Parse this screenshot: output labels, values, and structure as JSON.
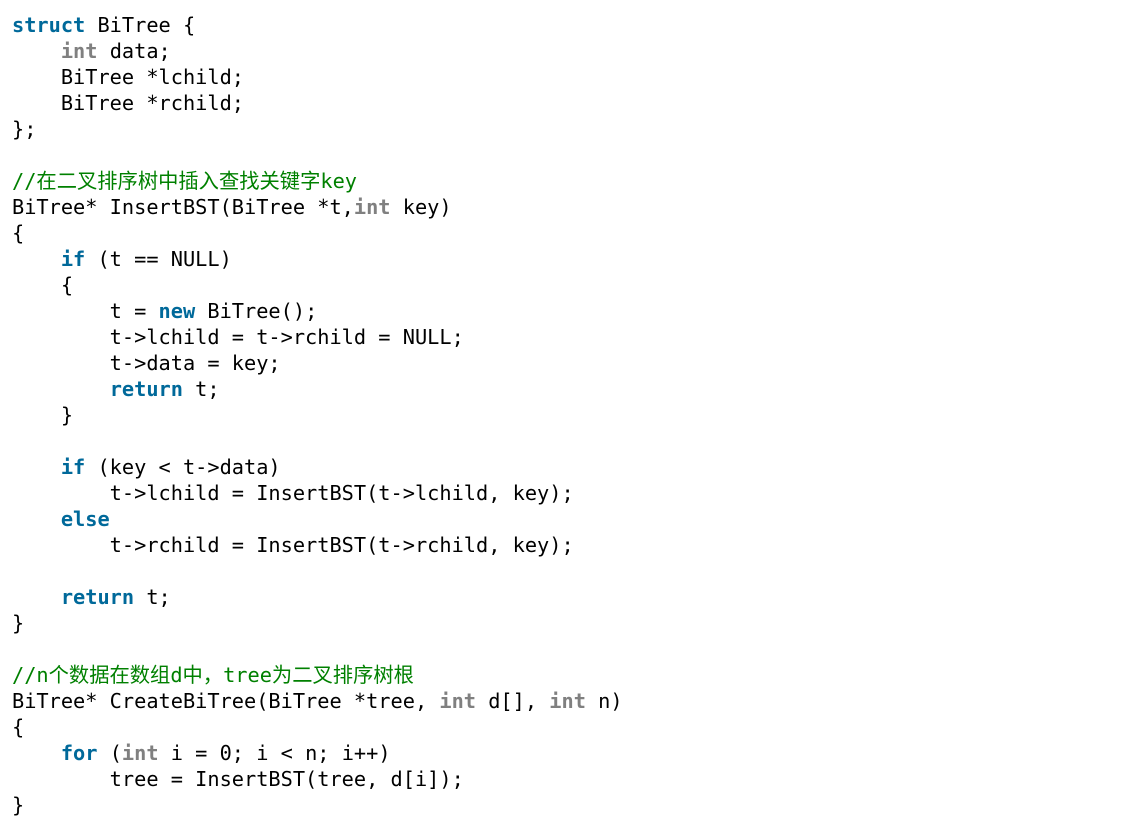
{
  "colors": {
    "background": "#ffffff",
    "keyword": "#00699a",
    "type_keyword": "#808080",
    "comment": "#008000",
    "plain": "#000000"
  },
  "code": {
    "lines": [
      [
        {
          "t": "kw",
          "v": "struct"
        },
        {
          "t": "pl",
          "v": " BiTree {"
        }
      ],
      [
        {
          "t": "pl",
          "v": "    "
        },
        {
          "t": "ty",
          "v": "int"
        },
        {
          "t": "pl",
          "v": " data;"
        }
      ],
      [
        {
          "t": "pl",
          "v": "    BiTree *lchild;"
        }
      ],
      [
        {
          "t": "pl",
          "v": "    BiTree *rchild;"
        }
      ],
      [
        {
          "t": "pl",
          "v": "};"
        }
      ],
      [],
      [
        {
          "t": "cm",
          "v": "//在二叉排序树中插入查找关键字key"
        }
      ],
      [
        {
          "t": "pl",
          "v": "BiTree* InsertBST(BiTree *t,"
        },
        {
          "t": "ty",
          "v": "int"
        },
        {
          "t": "pl",
          "v": " key)"
        }
      ],
      [
        {
          "t": "pl",
          "v": "{"
        }
      ],
      [
        {
          "t": "pl",
          "v": "    "
        },
        {
          "t": "kw",
          "v": "if"
        },
        {
          "t": "pl",
          "v": " (t == NULL)"
        }
      ],
      [
        {
          "t": "pl",
          "v": "    {"
        }
      ],
      [
        {
          "t": "pl",
          "v": "        t = "
        },
        {
          "t": "kw",
          "v": "new"
        },
        {
          "t": "pl",
          "v": " BiTree();"
        }
      ],
      [
        {
          "t": "pl",
          "v": "        t->lchild = t->rchild = NULL;"
        }
      ],
      [
        {
          "t": "pl",
          "v": "        t->data = key;"
        }
      ],
      [
        {
          "t": "pl",
          "v": "        "
        },
        {
          "t": "kw",
          "v": "return"
        },
        {
          "t": "pl",
          "v": " t;"
        }
      ],
      [
        {
          "t": "pl",
          "v": "    }"
        }
      ],
      [],
      [
        {
          "t": "pl",
          "v": "    "
        },
        {
          "t": "kw",
          "v": "if"
        },
        {
          "t": "pl",
          "v": " (key < t->data)"
        }
      ],
      [
        {
          "t": "pl",
          "v": "        t->lchild = InsertBST(t->lchild, key);"
        }
      ],
      [
        {
          "t": "pl",
          "v": "    "
        },
        {
          "t": "kw",
          "v": "else"
        }
      ],
      [
        {
          "t": "pl",
          "v": "        t->rchild = InsertBST(t->rchild, key);"
        }
      ],
      [],
      [
        {
          "t": "pl",
          "v": "    "
        },
        {
          "t": "kw",
          "v": "return"
        },
        {
          "t": "pl",
          "v": " t;"
        }
      ],
      [
        {
          "t": "pl",
          "v": "}"
        }
      ],
      [],
      [
        {
          "t": "cm",
          "v": "//n个数据在数组d中，tree为二叉排序树根"
        }
      ],
      [
        {
          "t": "pl",
          "v": "BiTree* CreateBiTree(BiTree *tree, "
        },
        {
          "t": "ty",
          "v": "int"
        },
        {
          "t": "pl",
          "v": " d[], "
        },
        {
          "t": "ty",
          "v": "int"
        },
        {
          "t": "pl",
          "v": " n)"
        }
      ],
      [
        {
          "t": "pl",
          "v": "{"
        }
      ],
      [
        {
          "t": "pl",
          "v": "    "
        },
        {
          "t": "kw",
          "v": "for"
        },
        {
          "t": "pl",
          "v": " ("
        },
        {
          "t": "ty",
          "v": "int"
        },
        {
          "t": "pl",
          "v": " i = 0; i < n; i++)"
        }
      ],
      [
        {
          "t": "pl",
          "v": "        tree = InsertBST(tree, d[i]);"
        }
      ],
      [
        {
          "t": "pl",
          "v": "}"
        }
      ]
    ]
  }
}
